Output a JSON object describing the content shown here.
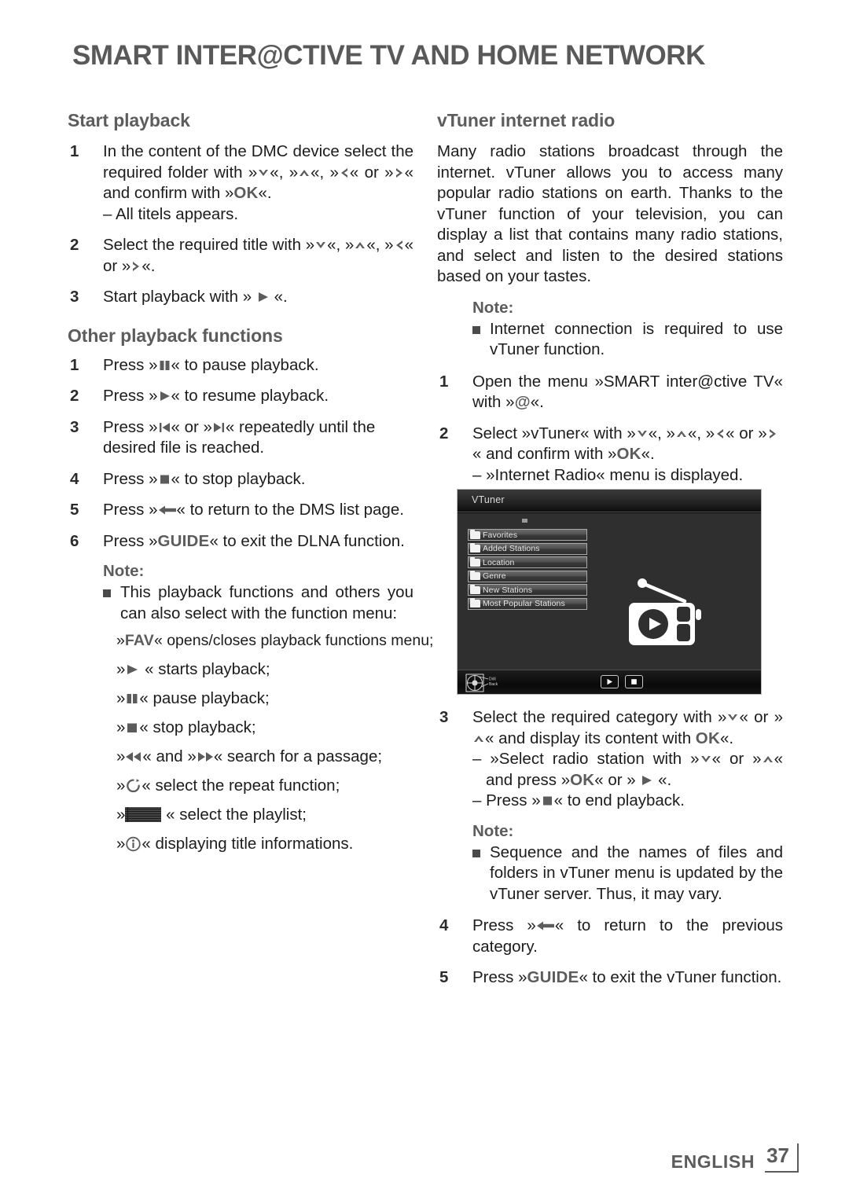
{
  "header": {
    "title": "SMART INTER@CTIVE TV AND HOME NETWORK"
  },
  "left_column": {
    "section1": {
      "heading": "Start playback",
      "steps": [
        {
          "num": "1",
          "text_a": "In the content of the DMC device select the required folder with »",
          "text_b": "«, »",
          "text_c": "«, »",
          "text_d": "« or »",
          "text_e": "« and confirm with »",
          "ok": "OK",
          "text_f": "«.",
          "sub": "– All titels appears."
        },
        {
          "num": "2",
          "text_a": "Select the required title with »",
          "text_b": "«, »",
          "text_c": "«, »",
          "text_d": "« or »",
          "text_e": "«."
        },
        {
          "num": "3",
          "text_a": "Start playback with »",
          "text_b": "«."
        }
      ]
    },
    "section2": {
      "heading": "Other playback functions",
      "steps": [
        {
          "num": "1",
          "text_a": "Press »",
          "text_b": "« to pause playback."
        },
        {
          "num": "2",
          "text_a": "Press »",
          "text_b": "« to resume playback."
        },
        {
          "num": "3",
          "text_a": "Press »",
          "text_b": "« or »",
          "text_c": "« repeatedly until the desired file is reached."
        },
        {
          "num": "4",
          "text_a": "Press »",
          "text_b": "« to stop playback."
        },
        {
          "num": "5",
          "text_a": "Press »",
          "text_b": "« to return to the DMS list page."
        },
        {
          "num": "6",
          "text_a": "Press »",
          "guide": "GUIDE",
          "text_b": "« to exit the DLNA function."
        }
      ],
      "note": {
        "title": "Note:",
        "item": "This playback functions and others you can also select with the function menu:"
      },
      "fn_lines": [
        {
          "pre": "»",
          "key": "FAV",
          "post": "« opens/closes playback functions menu;"
        },
        {
          "pre": "»",
          "icon": "play-icon",
          "post": "« starts playback;"
        },
        {
          "pre": "»",
          "icon": "pause-icon",
          "post": "« pause playback;"
        },
        {
          "pre": "»",
          "icon": "stop-icon",
          "post": "« stop playback;"
        },
        {
          "pre": "»",
          "icon": "rewind-icon",
          "mid": "« and »",
          "icon2": "fast-forward-icon",
          "post": "« search for a passage;"
        },
        {
          "pre": "»",
          "icon": "repeat-icon",
          "post": "« select the repeat function;"
        },
        {
          "pre": "»",
          "icon": "playlist-icon",
          "post": "« select the playlist;"
        },
        {
          "pre": "»",
          "icon": "info-icon",
          "post": "« displaying title informations."
        }
      ]
    }
  },
  "right_column": {
    "heading": "vTuner internet radio",
    "intro": "Many radio stations broadcast through the internet. vTuner allows you to access many popular radio stations on earth. Thanks to the vTuner function of your television, you can display a list that contains many radio stations, and select and listen to the desired stations based on your tastes.",
    "note1": {
      "title": "Note:",
      "item": "Internet connection is required to use vTuner function."
    },
    "steps_top": [
      {
        "num": "1",
        "text_a": "Open the menu »SMART inter@ctive TV« with »",
        "at": "@",
        "text_b": "«."
      },
      {
        "num": "2",
        "text_a": "Select »vTuner« with »",
        "text_b": "«, »",
        "text_c": "«, »",
        "text_d": "« or »",
        "text_e": "« and confirm with »",
        "ok": "OK",
        "text_f": "«.",
        "sub": "– »Internet Radio« menu is displayed."
      }
    ],
    "steps_bottom": [
      {
        "num": "3",
        "text_a": "Select the required category with »",
        "text_b": "« or »",
        "text_c": "« and display its content with ",
        "ok": "OK",
        "text_d": "«.",
        "sub1_a": "– »Select radio station with »",
        "sub1_b": "« or »",
        "sub1_c": "« and press »",
        "sub1_ok": "OK",
        "sub1_d": "« or »",
        "sub1_e": "«.",
        "sub2_a": "– Press »",
        "sub2_b": "« to end playback."
      }
    ],
    "note2": {
      "title": "Note:",
      "item": "Sequence and the names of files and folders in vTuner menu is updated by the vTuner server. Thus, it may vary."
    },
    "steps_tail": [
      {
        "num": "4",
        "text_a": "Press »",
        "text_b": "« to return to the previous category."
      },
      {
        "num": "5",
        "text_a": "Press »",
        "guide": "GUIDE",
        "text_b": "« to exit the vTuner function."
      }
    ]
  },
  "tv_screenshot": {
    "title": "VTuner",
    "menu_items": [
      "Favorites",
      "Added Stations",
      "Location",
      "Genre",
      "New Stations",
      "Most Popular Stations"
    ],
    "nav_labels": {
      "drill": "Drill",
      "back": "Back"
    },
    "transport": [
      "play-icon",
      "stop-icon"
    ]
  },
  "footer": {
    "language": "ENGLISH",
    "page": "37"
  },
  "colors": {
    "heading_grey": "#5c5c5c",
    "body_black": "#1c1c1c",
    "tv_background": "#2f2f2f"
  }
}
